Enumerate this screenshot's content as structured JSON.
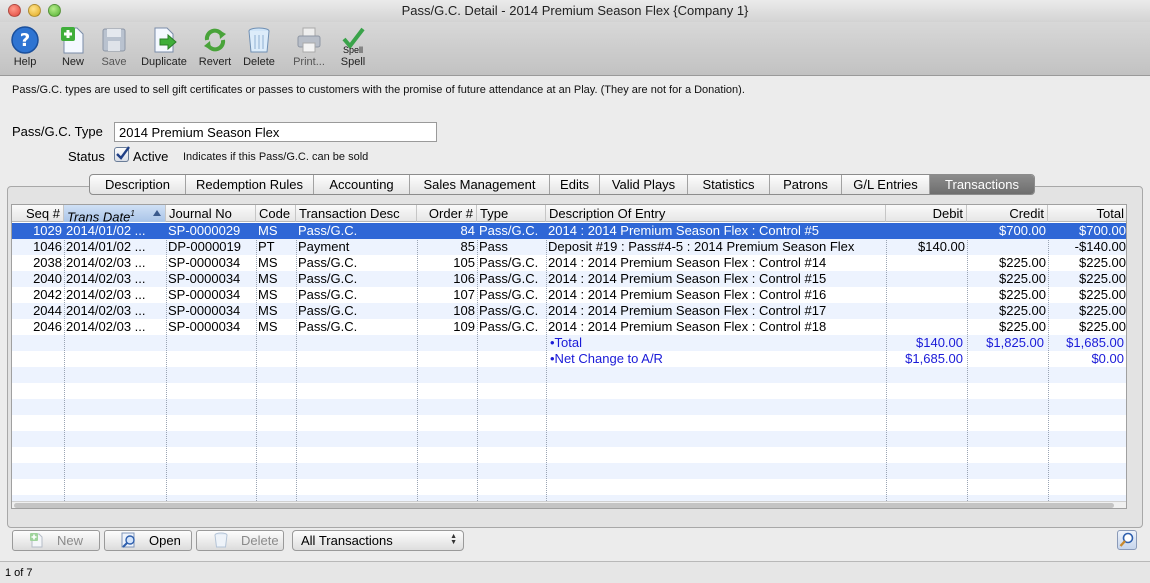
{
  "window": {
    "title": "Pass/G.C. Detail - 2014 Premium Season Flex {Company 1}"
  },
  "toolbar": {
    "help": "Help",
    "new": "New",
    "save": "Save",
    "duplicate": "Duplicate",
    "revert": "Revert",
    "delete": "Delete",
    "print": "Print...",
    "spell": "Spell",
    "spell_icon_text": "Spell"
  },
  "info_text": "Pass/G.C. types are used to sell gift certificates or passes to customers with the promise of future attendance at an Play.  (They are not for a Donation).",
  "form": {
    "type_label": "Pass/G.C. Type",
    "type_value": "2014 Premium Season Flex",
    "status_label": "Status",
    "active_checked": true,
    "active_label": "Active",
    "active_hint": "Indicates if this Pass/G.C. can be sold"
  },
  "tabs": [
    "Description",
    "Redemption Rules",
    "Accounting",
    "Sales Management",
    "Edits",
    "Valid Plays",
    "Statistics",
    "Patrons",
    "G/L Entries",
    "Transactions"
  ],
  "active_tab": "Transactions",
  "table": {
    "columns": {
      "seq": "Seq #",
      "date": "Trans Date",
      "date_sup": "1",
      "journal": "Journal No",
      "code": "Code",
      "tdesc": "Transaction Desc",
      "order": "Order #",
      "type": "Type",
      "entry": "Description Of Entry",
      "debit": "Debit",
      "credit": "Credit",
      "total": "Total"
    },
    "rows": [
      {
        "seq": "1029",
        "date": "2014/01/02 ...",
        "journal": "SP-0000029",
        "code": "MS",
        "tdesc": "Pass/G.C.",
        "order": "84",
        "type": "Pass/G.C.",
        "entry": "2014 : 2014 Premium Season Flex : Control #5",
        "debit": "",
        "credit": "$700.00",
        "total": "$700.00"
      },
      {
        "seq": "1046",
        "date": "2014/01/02 ...",
        "journal": "DP-0000019",
        "code": "PT",
        "tdesc": "Payment",
        "order": "85",
        "type": "Pass",
        "entry": "Deposit #19 : Pass#4-5 : 2014 Premium Season Flex",
        "debit": "$140.00",
        "credit": "",
        "total": "-$140.00"
      },
      {
        "seq": "2038",
        "date": "2014/02/03 ...",
        "journal": "SP-0000034",
        "code": "MS",
        "tdesc": "Pass/G.C.",
        "order": "105",
        "type": "Pass/G.C.",
        "entry": "2014 : 2014 Premium Season Flex : Control #14",
        "debit": "",
        "credit": "$225.00",
        "total": "$225.00"
      },
      {
        "seq": "2040",
        "date": "2014/02/03 ...",
        "journal": "SP-0000034",
        "code": "MS",
        "tdesc": "Pass/G.C.",
        "order": "106",
        "type": "Pass/G.C.",
        "entry": "2014 : 2014 Premium Season Flex : Control #15",
        "debit": "",
        "credit": "$225.00",
        "total": "$225.00"
      },
      {
        "seq": "2042",
        "date": "2014/02/03 ...",
        "journal": "SP-0000034",
        "code": "MS",
        "tdesc": "Pass/G.C.",
        "order": "107",
        "type": "Pass/G.C.",
        "entry": "2014 : 2014 Premium Season Flex : Control #16",
        "debit": "",
        "credit": "$225.00",
        "total": "$225.00"
      },
      {
        "seq": "2044",
        "date": "2014/02/03 ...",
        "journal": "SP-0000034",
        "code": "MS",
        "tdesc": "Pass/G.C.",
        "order": "108",
        "type": "Pass/G.C.",
        "entry": "2014 : 2014 Premium Season Flex : Control #17",
        "debit": "",
        "credit": "$225.00",
        "total": "$225.00"
      },
      {
        "seq": "2046",
        "date": "2014/02/03 ...",
        "journal": "SP-0000034",
        "code": "MS",
        "tdesc": "Pass/G.C.",
        "order": "109",
        "type": "Pass/G.C.",
        "entry": "2014 : 2014 Premium Season Flex : Control #18",
        "debit": "",
        "credit": "$225.00",
        "total": "$225.00"
      }
    ],
    "total_row": {
      "label": "•Total",
      "debit": "$140.00",
      "credit": "$1,825.00",
      "total": "$1,685.00"
    },
    "net_row": {
      "label": "•Net Change to A/R",
      "debit": "$1,685.00",
      "total": "$0.00"
    },
    "selected_row": 0
  },
  "bottom": {
    "new_label": "New",
    "open_label": "Open",
    "delete_label": "Delete",
    "filter_value": "All Transactions"
  },
  "status": {
    "record": "1 of 7"
  },
  "colors": {
    "selection": "#2f67d6",
    "total_text": "#1a1ad8",
    "stripe": "#edf3fe"
  }
}
